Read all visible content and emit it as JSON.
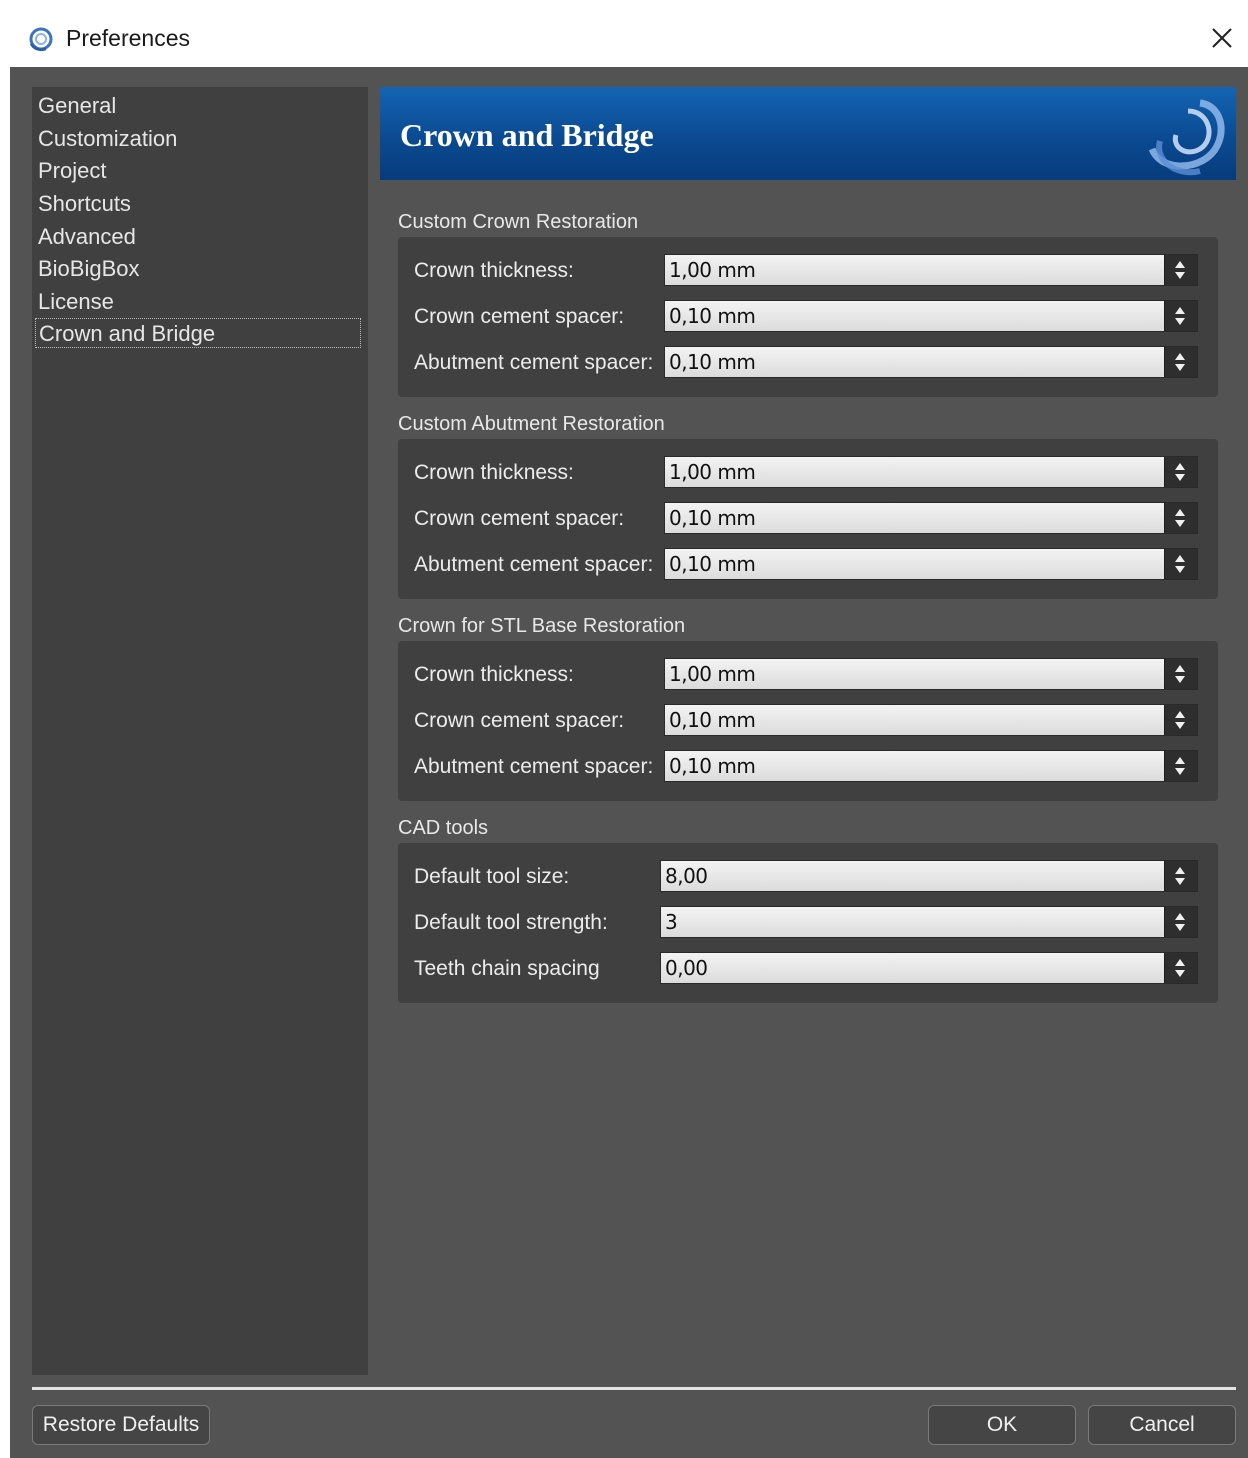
{
  "window": {
    "title": "Preferences",
    "close_icon": "close-icon"
  },
  "sidebar": {
    "items": [
      {
        "label": "General"
      },
      {
        "label": "Customization"
      },
      {
        "label": "Project"
      },
      {
        "label": "Shortcuts"
      },
      {
        "label": "Advanced"
      },
      {
        "label": "BioBigBox"
      },
      {
        "label": "License"
      },
      {
        "label": "Crown and Bridge",
        "selected": true
      }
    ]
  },
  "header": {
    "title": "Crown and Bridge",
    "accent_color": "#0b4a92"
  },
  "groups": [
    {
      "title": "Custom Crown Restoration",
      "fields": [
        {
          "label": "Crown thickness:",
          "value": "1,00 mm"
        },
        {
          "label": "Crown cement spacer:",
          "value": "0,10 mm"
        },
        {
          "label": "Abutment cement spacer:",
          "value": "0,10 mm"
        }
      ]
    },
    {
      "title": "Custom Abutment Restoration",
      "fields": [
        {
          "label": "Crown thickness:",
          "value": "1,00 mm"
        },
        {
          "label": "Crown cement spacer:",
          "value": "0,10 mm"
        },
        {
          "label": "Abutment cement spacer:",
          "value": "0,10 mm"
        }
      ]
    },
    {
      "title": "Crown for STL Base Restoration",
      "fields": [
        {
          "label": "Crown thickness:",
          "value": "1,00 mm"
        },
        {
          "label": "Crown cement spacer:",
          "value": "0,10 mm"
        },
        {
          "label": "Abutment cement spacer:",
          "value": "0,10 mm"
        }
      ]
    },
    {
      "title": "CAD tools",
      "fields": [
        {
          "label": "Default tool size:",
          "value": "8,00"
        },
        {
          "label": "Default tool strength:",
          "value": "3"
        },
        {
          "label": "Teeth chain spacing",
          "value": "0,00"
        }
      ]
    }
  ],
  "footer": {
    "restore_label": "Restore Defaults",
    "ok_label": "OK",
    "cancel_label": "Cancel"
  }
}
